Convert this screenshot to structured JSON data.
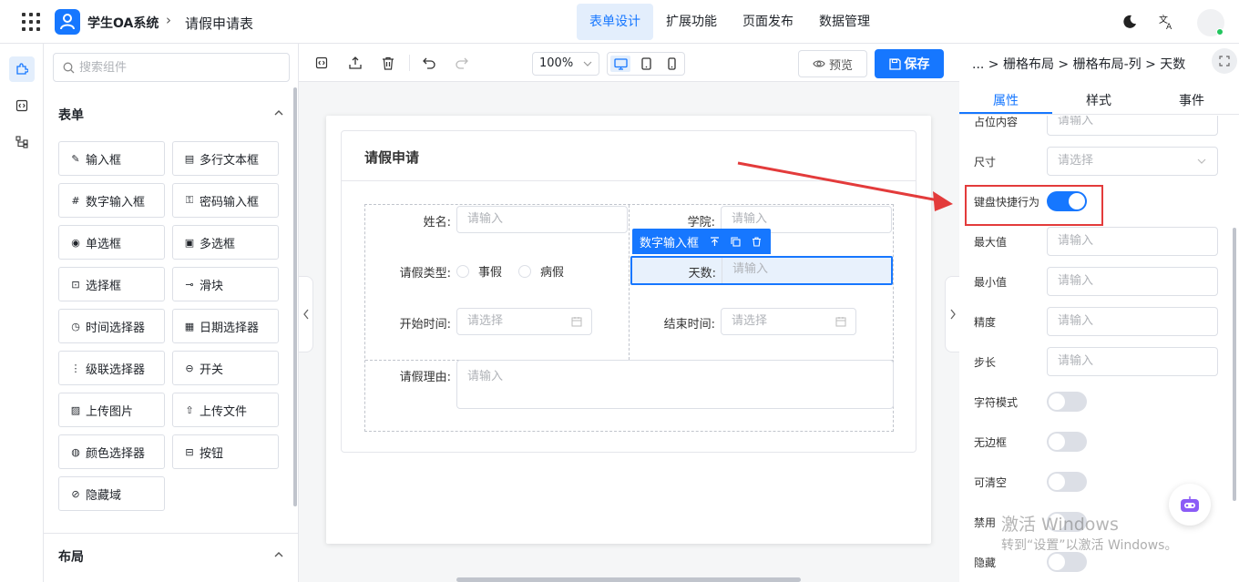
{
  "header": {
    "app_name": "学生OA系统",
    "page_name": "请假申请表",
    "tabs": [
      {
        "label": "表单设计",
        "active": true
      },
      {
        "label": "扩展功能",
        "active": false
      },
      {
        "label": "页面发布",
        "active": false
      },
      {
        "label": "数据管理",
        "active": false
      }
    ]
  },
  "components": {
    "search_placeholder": "搜索组件",
    "section_form": "表单",
    "section_layout": "布局",
    "items": [
      {
        "label": "输入框",
        "icon": "pen-icon"
      },
      {
        "label": "多行文本框",
        "icon": "textarea-icon"
      },
      {
        "label": "数字输入框",
        "icon": "number-icon"
      },
      {
        "label": "密码输入框",
        "icon": "lock-icon"
      },
      {
        "label": "单选框",
        "icon": "radio-icon"
      },
      {
        "label": "多选框",
        "icon": "checkbox-icon"
      },
      {
        "label": "选择框",
        "icon": "select-icon"
      },
      {
        "label": "滑块",
        "icon": "slider-icon"
      },
      {
        "label": "时间选择器",
        "icon": "clock-icon"
      },
      {
        "label": "日期选择器",
        "icon": "calendar-icon"
      },
      {
        "label": "级联选择器",
        "icon": "cascader-icon"
      },
      {
        "label": "开关",
        "icon": "switch-icon"
      },
      {
        "label": "上传图片",
        "icon": "image-icon"
      },
      {
        "label": "上传文件",
        "icon": "upload-icon"
      },
      {
        "label": "颜色选择器",
        "icon": "palette-icon"
      },
      {
        "label": "按钮",
        "icon": "button-icon"
      },
      {
        "label": "隐藏域",
        "icon": "eye-off-icon"
      }
    ]
  },
  "toolbar": {
    "zoom": "100%",
    "preview_label": "预览",
    "save_label": "保存"
  },
  "form": {
    "title": "请假申请",
    "name_label": "姓名:",
    "name_placeholder": "请输入",
    "college_label": "学院:",
    "college_placeholder": "请输入",
    "type_label": "请假类型:",
    "type_options": [
      "事假",
      "病假"
    ],
    "days_label": "天数:",
    "days_placeholder": "请输入",
    "start_label": "开始时间:",
    "start_placeholder": "请选择",
    "end_label": "结束时间:",
    "end_placeholder": "请选择",
    "reason_label": "请假理由:",
    "reason_placeholder": "请输入",
    "selected_component": "数字输入框"
  },
  "props": {
    "breadcrumb": "... > 栅格布局 > 栅格布局-列 > 天数",
    "tabs": [
      "属性",
      "样式",
      "事件"
    ],
    "rows": [
      {
        "label": "占位内容",
        "type": "input",
        "value": "请输入"
      },
      {
        "label": "尺寸",
        "type": "select",
        "value": "请选择"
      },
      {
        "label": "键盘快捷行为",
        "type": "switch",
        "on": true
      },
      {
        "label": "最大值",
        "type": "input",
        "value": "请输入"
      },
      {
        "label": "最小值",
        "type": "input",
        "value": "请输入"
      },
      {
        "label": "精度",
        "type": "input",
        "value": "请输入"
      },
      {
        "label": "步长",
        "type": "input",
        "value": "请输入"
      },
      {
        "label": "字符模式",
        "type": "switch",
        "on": false
      },
      {
        "label": "无边框",
        "type": "switch",
        "on": false
      },
      {
        "label": "可清空",
        "type": "switch",
        "on": false
      },
      {
        "label": "禁用",
        "type": "switch",
        "on": false
      },
      {
        "label": "隐藏",
        "type": "switch",
        "on": false
      }
    ]
  },
  "watermark": {
    "line1": "激活 Windows",
    "line2": "转到“设置”以激活 Windows。"
  },
  "colors": {
    "primary": "#1677ff",
    "annotation": "#e33b3b"
  }
}
